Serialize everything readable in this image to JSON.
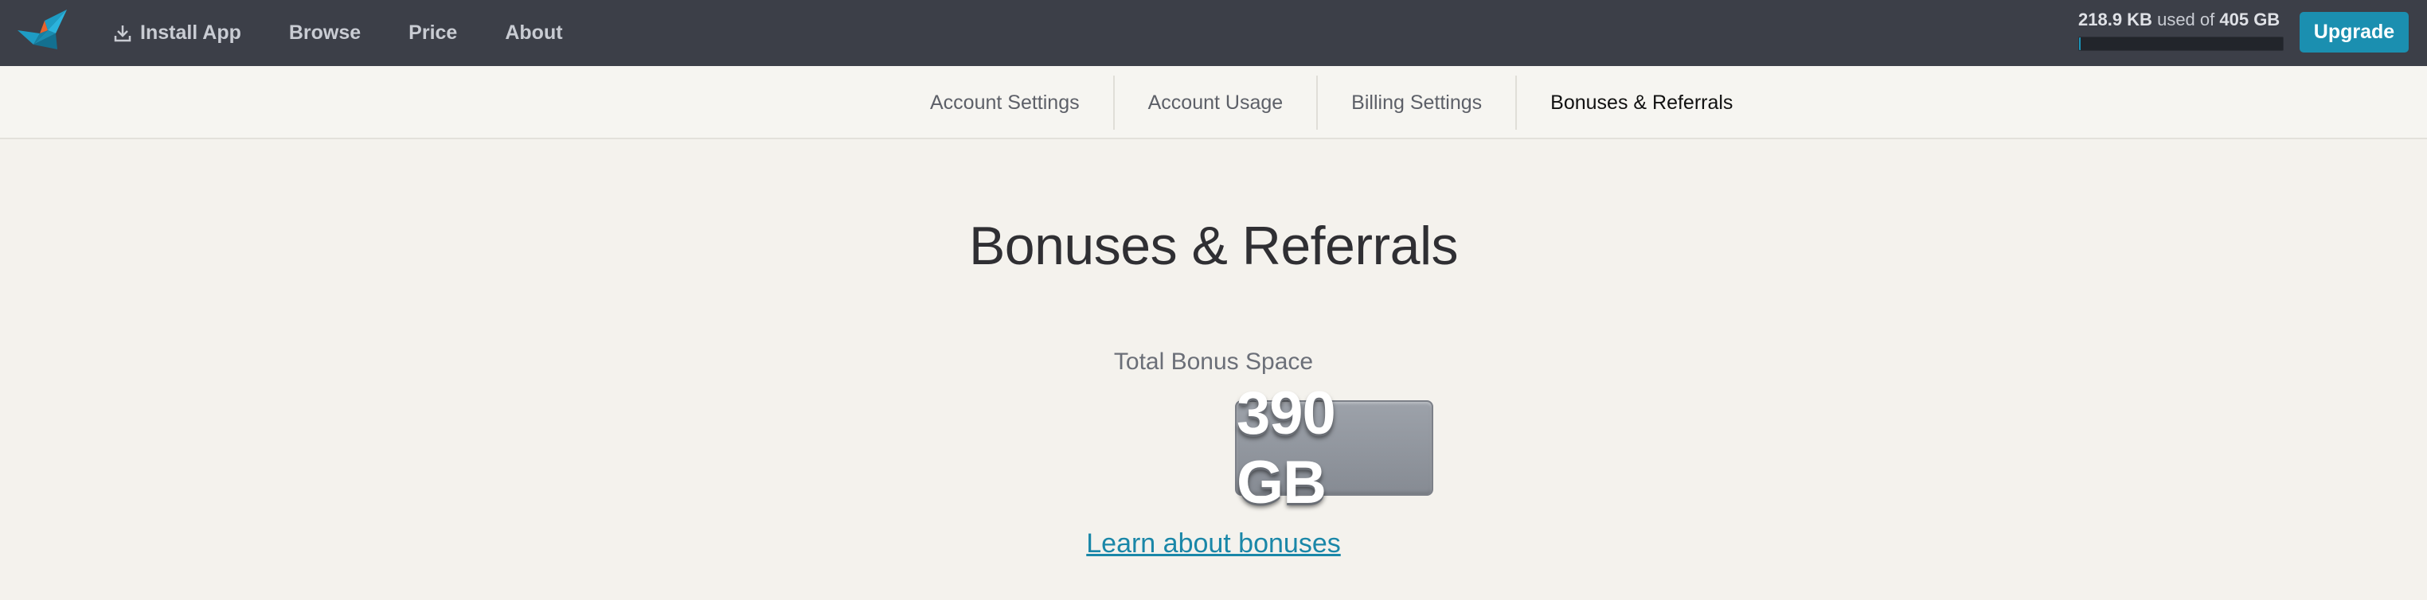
{
  "header": {
    "nav": [
      {
        "label": "Install App",
        "icon": "download-icon"
      },
      {
        "label": "Browse"
      },
      {
        "label": "Price"
      },
      {
        "label": "About"
      }
    ],
    "usage": {
      "used": "218.9 KB",
      "used_word": "used of",
      "total": "405 GB",
      "fraction": 5e-07
    },
    "upgrade_label": "Upgrade"
  },
  "subnav": {
    "tabs": [
      {
        "label": "Account Settings",
        "active": false
      },
      {
        "label": "Account Usage",
        "active": false
      },
      {
        "label": "Billing Settings",
        "active": false
      },
      {
        "label": "Bonuses & Referrals",
        "active": true
      }
    ]
  },
  "main": {
    "title": "Bonuses & Referrals",
    "bonus_label": "Total Bonus Space",
    "bonus_value": "390 GB",
    "learn_link": "Learn about bonuses"
  },
  "colors": {
    "topbar": "#3c3f48",
    "accent": "#1b8fb0",
    "link": "#1a87a8"
  }
}
